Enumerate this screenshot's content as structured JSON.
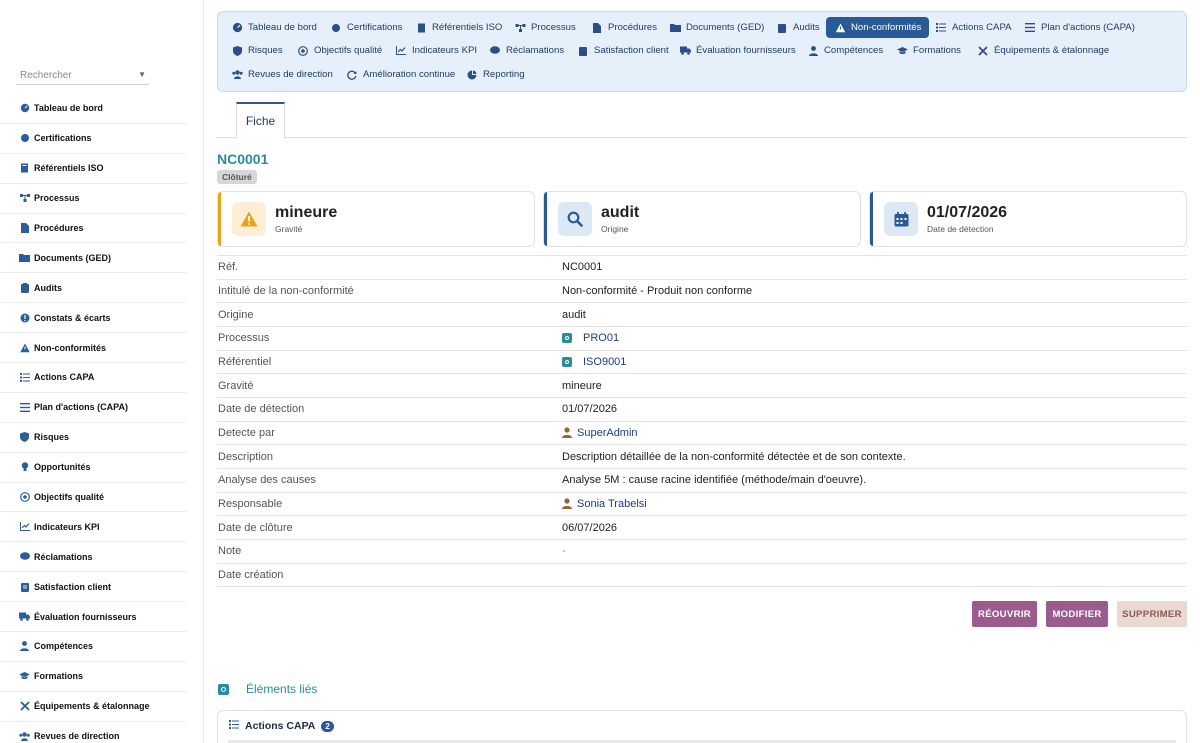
{
  "search": {
    "placeholder": "Rechercher"
  },
  "sidebar": {
    "items": [
      {
        "label": "Tableau de bord",
        "icon": "dashboard-icon"
      },
      {
        "label": "Certifications",
        "icon": "certificate-icon"
      },
      {
        "label": "Référentiels ISO",
        "icon": "book-icon"
      },
      {
        "label": "Processus",
        "icon": "sitemap-icon"
      },
      {
        "label": "Procédures",
        "icon": "file-icon"
      },
      {
        "label": "Documents (GED)",
        "icon": "folder-icon"
      },
      {
        "label": "Audits",
        "icon": "clipboard-icon"
      },
      {
        "label": "Constats & écarts",
        "icon": "info-icon"
      },
      {
        "label": "Non-conformités",
        "icon": "warning-icon"
      },
      {
        "label": "Actions CAPA",
        "icon": "list-icon"
      },
      {
        "label": "Plan d'actions (CAPA)",
        "icon": "bars-icon"
      },
      {
        "label": "Risques",
        "icon": "shield-icon"
      },
      {
        "label": "Opportunités",
        "icon": "lightbulb-icon"
      },
      {
        "label": "Objectifs qualité",
        "icon": "target-icon"
      },
      {
        "label": "Indicateurs KPI",
        "icon": "chart-line-icon"
      },
      {
        "label": "Réclamations",
        "icon": "comment-icon"
      },
      {
        "label": "Satisfaction client",
        "icon": "clipboard-check-icon"
      },
      {
        "label": "Évaluation fournisseurs",
        "icon": "truck-icon"
      },
      {
        "label": "Compétences",
        "icon": "user-tie-icon"
      },
      {
        "label": "Formations",
        "icon": "graduation-cap-icon"
      },
      {
        "label": "Équipements & étalonnage",
        "icon": "tools-icon"
      },
      {
        "label": "Revues de direction",
        "icon": "users-icon"
      }
    ]
  },
  "topnav": {
    "items": [
      {
        "label": "Tableau de bord"
      },
      {
        "label": "Certifications"
      },
      {
        "label": "Référentiels ISO"
      },
      {
        "label": "Processus"
      },
      {
        "label": "Procédures"
      },
      {
        "label": "Documents (GED)"
      },
      {
        "label": "Audits"
      },
      {
        "label": "Non-conformités",
        "active": true
      },
      {
        "label": "Actions CAPA"
      },
      {
        "label": "Plan d'actions (CAPA)"
      },
      {
        "label": "Risques"
      },
      {
        "label": "Objectifs qualité"
      },
      {
        "label": "Indicateurs KPI"
      },
      {
        "label": "Réclamations"
      },
      {
        "label": "Satisfaction client"
      },
      {
        "label": "Évaluation fournisseurs"
      },
      {
        "label": "Compétences"
      },
      {
        "label": "Formations"
      },
      {
        "label": "Équipements & étalonnage"
      },
      {
        "label": "Revues de direction"
      },
      {
        "label": "Amélioration continue"
      },
      {
        "label": "Reporting"
      }
    ]
  },
  "tabs": {
    "fiche": "Fiche"
  },
  "nc": {
    "code": "NC0001",
    "status": "Clôturé",
    "cards": [
      {
        "value": "mineure",
        "label": "Gravité",
        "color": "#e8a317"
      },
      {
        "value": "audit",
        "label": "Origine",
        "color": "#285b95"
      },
      {
        "value": "01/07/2026",
        "label": "Date de détection",
        "color": "#285b95"
      }
    ]
  },
  "details": [
    {
      "k": "Réf.",
      "v": "NC0001"
    },
    {
      "k": "Intitulé de la non-conformité",
      "v": "Non-conformité - Produit non conforme"
    },
    {
      "k": "Origine",
      "v": "audit"
    },
    {
      "k": "Processus",
      "v": "PRO01"
    },
    {
      "k": "Référentiel",
      "v": "ISO9001"
    },
    {
      "k": "Gravité",
      "v": "mineure"
    },
    {
      "k": "Date de détection",
      "v": "01/07/2026"
    },
    {
      "k": "Detecte par",
      "v": "SuperAdmin"
    },
    {
      "k": "Description",
      "v": "Description détaillée de la non-conformité détectée et de son contexte."
    },
    {
      "k": "Analyse des causes",
      "v": "Analyse 5M : cause racine identifiée (méthode/main d'oeuvre)."
    },
    {
      "k": "Responsable",
      "v": "Sonia Trabelsi"
    },
    {
      "k": "Date de clôture",
      "v": "06/07/2026"
    },
    {
      "k": "Note",
      "v": "-"
    },
    {
      "k": "Date création",
      "v": ""
    }
  ],
  "buttons": {
    "reopen": "RÉOUVRIR",
    "modify": "MODIFIER",
    "delete": "SUPPRIMER"
  },
  "linked": {
    "title": "Éléments liés",
    "capa_title": "Actions CAPA",
    "capa_count": "2"
  }
}
